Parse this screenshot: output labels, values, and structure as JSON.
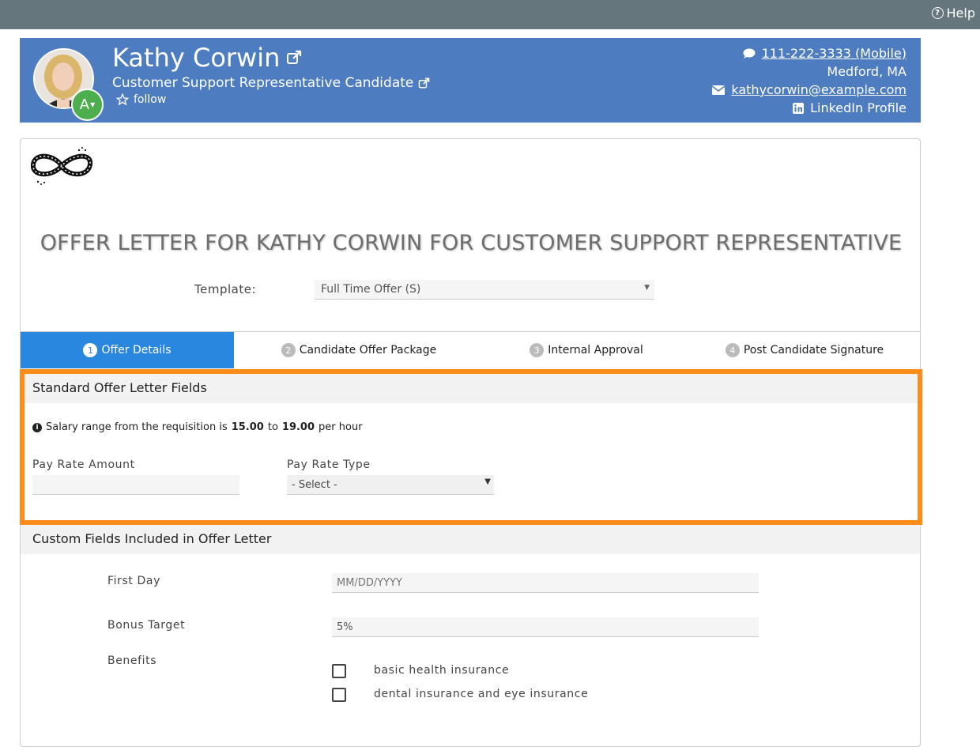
{
  "topbar": {
    "help_label": "Help"
  },
  "candidate": {
    "name": "Kathy Corwin",
    "title": "Customer Support Representative Candidate",
    "badge_letter": "A",
    "follow_label": "follow",
    "phone": "111-222-3333 (Mobile)",
    "location": "Medford, MA",
    "email": "kathycorwin@example.com",
    "linkedin": "LinkedIn Profile"
  },
  "offer": {
    "heading": "OFFER LETTER FOR KATHY CORWIN FOR CUSTOMER SUPPORT REPRESENTATIVE",
    "template_label": "Template:",
    "template_value": "Full Time Offer (S)"
  },
  "tabs": [
    {
      "num": "1",
      "label": "Offer Details"
    },
    {
      "num": "2",
      "label": "Candidate Offer Package"
    },
    {
      "num": "3",
      "label": "Internal Approval"
    },
    {
      "num": "4",
      "label": "Post Candidate Signature"
    }
  ],
  "standard_fields": {
    "heading": "Standard Offer Letter Fields",
    "info_prefix": "Salary range from the requisition is",
    "range_min": "15.00",
    "range_to": "to",
    "range_max": "19.00",
    "info_suffix": "per hour",
    "pay_rate_amount_label": "Pay Rate Amount",
    "pay_rate_amount_value": "",
    "pay_rate_type_label": "Pay Rate Type",
    "pay_rate_type_value": "- Select -"
  },
  "custom_fields": {
    "heading": "Custom Fields Included in Offer Letter",
    "first_day_label": "First Day",
    "first_day_placeholder": "MM/DD/YYYY",
    "bonus_label": "Bonus Target",
    "bonus_value": "5%",
    "benefits_label": "Benefits",
    "benefits_options": [
      "basic health insurance",
      "dental insurance and eye insurance"
    ]
  },
  "colors": {
    "topbar": "#66767d",
    "header": "#4d7dc0",
    "active_tab": "#2a87e0",
    "highlight": "#ff8c1a",
    "badge": "#4cae4c"
  }
}
